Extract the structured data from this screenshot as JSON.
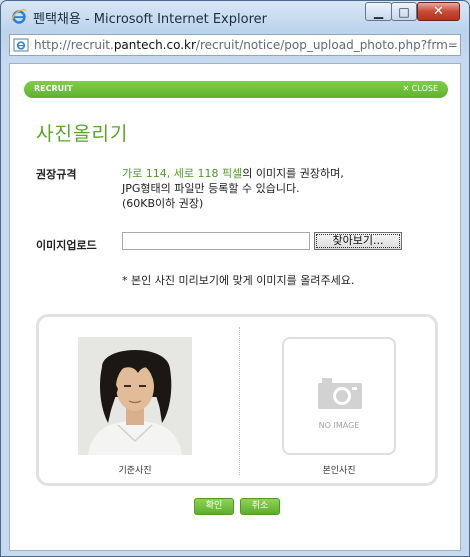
{
  "window": {
    "title": "펜택채용 - Microsoft Internet Explorer",
    "minimize_glyph": "▁",
    "maximize_glyph": "□",
    "close_glyph": "✕"
  },
  "address": {
    "prefix": "http://recruit.",
    "domain": "pantech.co.kr",
    "suffix": "/recruit/notice/pop_upload_photo.php?frm=regis"
  },
  "header": {
    "label": "RECRUIT",
    "close_label": "✕ CLOSE"
  },
  "page": {
    "heading": "사진올리기"
  },
  "spec": {
    "label": "권장규격",
    "highlight": "가로 114, 세로 118 픽셀",
    "line1_rest": "의 이미지를 권장하며,",
    "line2": "JPG형태의 파일만 등록할 수 있습니다.",
    "line3": "(60KB이하 권장)"
  },
  "upload": {
    "label": "이미지업로드",
    "value": "",
    "browse_label": "찾아보기..."
  },
  "note": "* 본인 사진 미리보기에 맞게 이미지를 올려주세요.",
  "preview": {
    "sample_caption": "기준사진",
    "no_image_text": "NO IMAGE",
    "mine_caption": "본인사진"
  },
  "buttons": {
    "ok": "확인",
    "cancel": "취소"
  },
  "colors": {
    "accent_green": "#5fb22e",
    "heading_green": "#57a624"
  },
  "icons": [
    "ie-logo-icon",
    "page-icon",
    "camera-icon"
  ]
}
